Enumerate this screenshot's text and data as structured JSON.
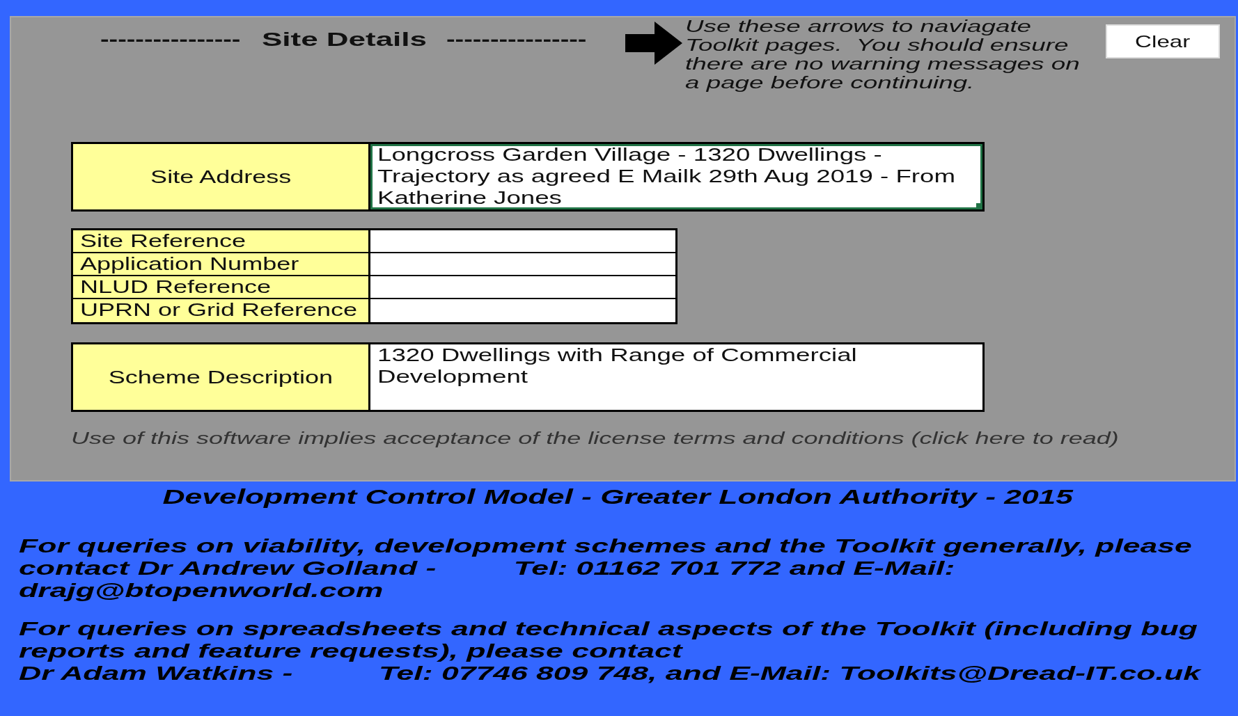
{
  "header": {
    "dashes_left": "----------------",
    "title": "Site Details",
    "dashes_right": "----------------"
  },
  "navigation_note": "Use these arrows to naviagate\nToolkit pages.  You should ensure\nthere are no warning messages on\na page before continuing.",
  "clear_button": "Clear",
  "site_address": {
    "label": "Site Address",
    "value": "Longcross Garden Village - 1320 Dwellings -\nTrajectory as agreed E Mailk 29th Aug 2019 - From\nKatherine Jones",
    "selected": true
  },
  "references": [
    {
      "label": "Site Reference"
    },
    {
      "label": "Application Number"
    },
    {
      "label": "NLUD Reference"
    },
    {
      "label": "UPRN or Grid Reference"
    }
  ],
  "scheme_description": {
    "label": "Scheme Description",
    "value": "1320 Dwellings with Range of Commercial\nDevelopment",
    "selected": false
  },
  "license_note": "Use of this software implies acceptance of the license terms and conditions (click here to read)",
  "footer": {
    "title": "Development Control Model - Greater London Authority - 2015",
    "paragraphs": [
      "For queries on viability, development schemes and the Toolkit generally, please\ncontact Dr Andrew Golland -         Tel: 01162 701 772 and E-Mail:\ndrajg@btopenworld.com",
      "For queries on spreadsheets and technical aspects of the Toolkit (including bug\nreports and feature requests), please contact\nDr Adam Watkins -          Tel: 07746 809 748, and E-Mail: Toolkits@Dread-IT.co.uk"
    ]
  }
}
